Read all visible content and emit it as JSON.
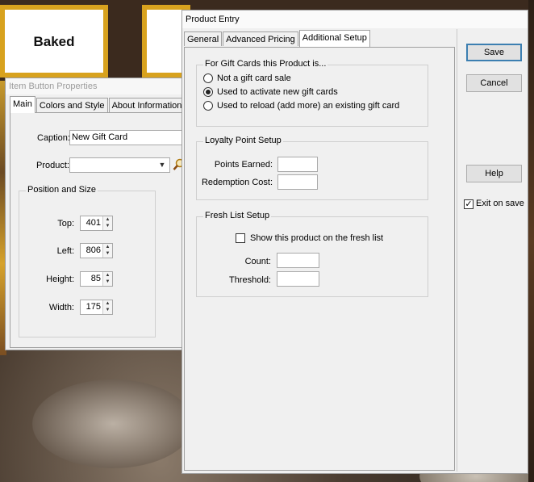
{
  "background": {
    "tile_label": "Baked"
  },
  "item_button_properties": {
    "title": "Item Button Properties",
    "tabs": [
      "Main",
      "Colors and Style",
      "About Information"
    ],
    "caption_label": "Caption:",
    "caption_value": "New Gift Card",
    "product_label": "Product:",
    "product_value": "",
    "position_group": "Position and Size",
    "top_label": "Top:",
    "top_value": "401",
    "left_label": "Left:",
    "left_value": "806",
    "height_label": "Height:",
    "height_value": "85",
    "width_label": "Width:",
    "width_value": "175"
  },
  "product_entry": {
    "title": "Product Entry",
    "tabs": [
      "General",
      "Advanced Pricing",
      "Additional Setup"
    ],
    "gift_group": "For Gift Cards this Product is...",
    "gift_options": [
      {
        "label": "Not a gift card sale",
        "checked": false
      },
      {
        "label": "Used to activate new gift cards",
        "checked": true
      },
      {
        "label": "Used to reload (add more) an existing gift card",
        "checked": false
      }
    ],
    "loyalty_group": "Loyalty Point Setup",
    "points_earned_label": "Points Earned:",
    "points_earned_value": "",
    "redemption_cost_label": "Redemption Cost:",
    "redemption_cost_value": "",
    "fresh_group": "Fresh List Setup",
    "fresh_check_label": "Show this product on the fresh list",
    "count_label": "Count:",
    "count_value": "",
    "threshold_label": "Threshold:",
    "threshold_value": "",
    "save_label": "Save",
    "cancel_label": "Cancel",
    "help_label": "Help",
    "exit_on_save_label": "Exit on save",
    "exit_on_save_checked": true
  }
}
